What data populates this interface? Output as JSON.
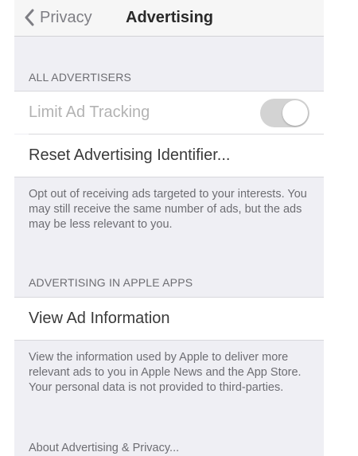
{
  "navbar": {
    "back_label": "Privacy",
    "title": "Advertising"
  },
  "sections": {
    "all_advertisers_header": "ALL ADVERTISERS",
    "limit_ad_tracking_label": "Limit Ad Tracking",
    "limit_ad_tracking_on": false,
    "reset_identifier_label": "Reset Advertising Identifier...",
    "opt_out_footer": "Opt out of receiving ads targeted to your interests. You may still receive the same number of ads, but the ads may be less relevant to you.",
    "apple_apps_header": "ADVERTISING IN APPLE APPS",
    "view_ad_info_label": "View Ad Information",
    "apple_apps_footer": "View the information used by Apple to deliver more relevant ads to you in Apple News and the App Store. Your personal data is not provided to third-parties.",
    "about_link": "About Advertising & Privacy..."
  },
  "colors": {
    "background": "#efeff4",
    "cell": "#ffffff",
    "toggle_off": "#d3d3d3"
  },
  "icons": {
    "back": "chevron-left-icon"
  }
}
